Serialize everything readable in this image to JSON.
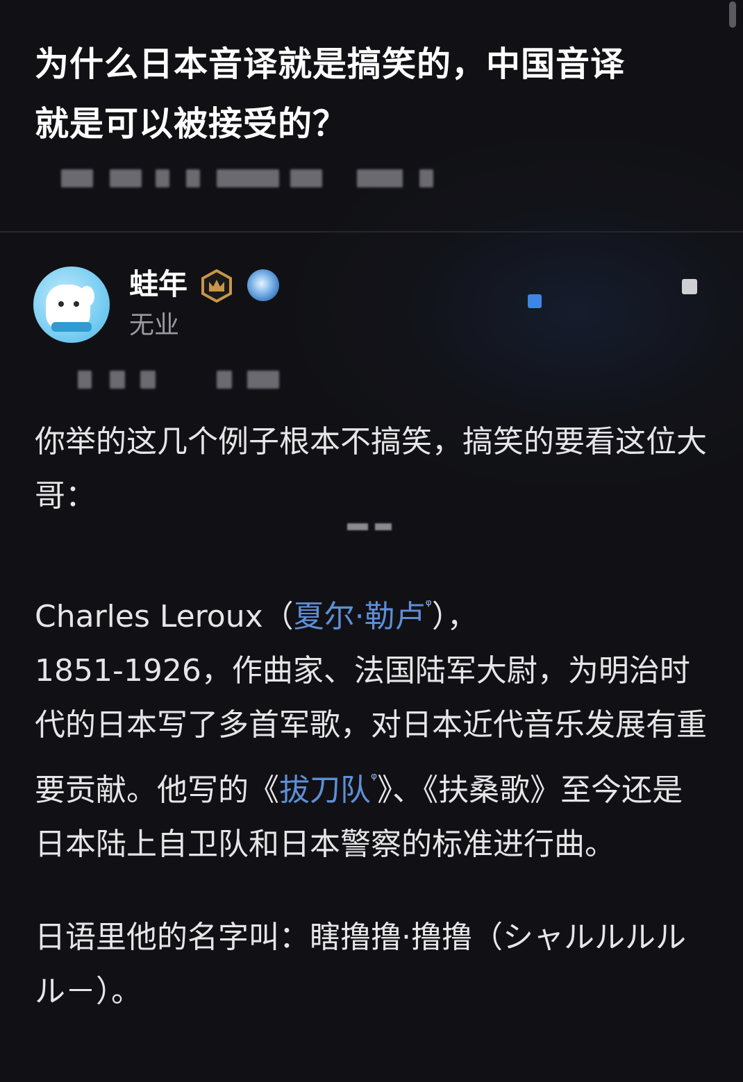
{
  "question": {
    "title_line1": "为什么日本音译就是搞笑的，中国音译",
    "title_line2": "就是可以被接受的？"
  },
  "author": {
    "name": "蛙年",
    "subtitle": "无业",
    "avatar_icon": "dog-avatar-icon",
    "badge_icons": [
      "crown-badge-icon",
      "globe-badge-icon"
    ]
  },
  "answer": {
    "para1": "你举的这几个例子根本不搞笑，搞笑的要看这位大哥：",
    "para2_prefix": "Charles Leroux（",
    "para2_link": "夏尔·勒卢",
    "para2_suffix": "），",
    "para2_body_a": "1851-1926，作曲家、法国陆军大尉，为明治时代的日本写了多首军歌，对日本近代音乐发展有重要贡献。他写的《",
    "para2_link2": "拔刀队",
    "para2_body_b": "》、《扶桑歌》至今还是日本陆上自卫队和日本警察的标准进行曲。",
    "para3": "日语里他的名字叫：瞎撸撸·撸撸（シャルルルルル－）。",
    "search_glyph": "ᵠ"
  },
  "colors": {
    "background": "#111115",
    "link": "#5e8fd6",
    "text": "#e6e6e8",
    "subtext": "#9a9aa0"
  }
}
